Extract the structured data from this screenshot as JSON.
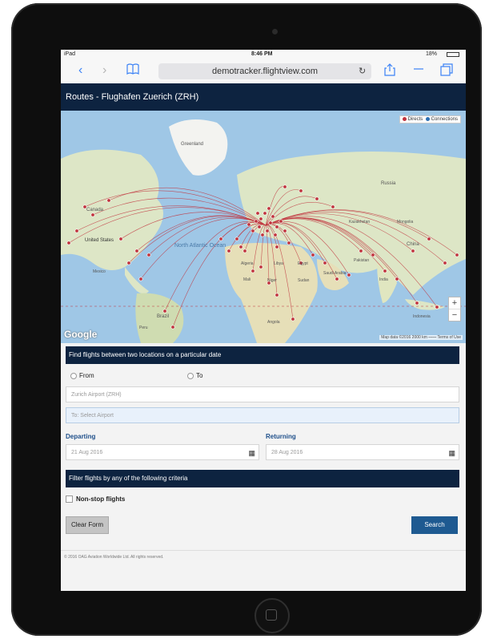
{
  "status_bar": {
    "carrier": "iPad",
    "time": "8:46 PM",
    "battery": "18%"
  },
  "browser": {
    "url": "demotracker.flightview.com"
  },
  "header": {
    "title": "Routes - Flughafen Zuerich (ZRH)"
  },
  "map": {
    "legend_direct": "Directs",
    "legend_connections": "Connections",
    "labels": {
      "greenland": "Greenland",
      "canada": "Canada",
      "united_states": "United States",
      "mexico": "Mexico",
      "north_atlantic": "North Atlantic Ocean",
      "brazil": "Brazil",
      "algeria": "Algeria",
      "mali": "Mali",
      "niger": "Niger",
      "libya": "Libya",
      "egypt": "Egypt",
      "sudan": "Sudan",
      "saudi_arabia": "Saudi Arabia",
      "pakistan": "Pakistan",
      "india": "India",
      "kazakhstan": "Kazakhstan",
      "russia": "Russia",
      "mongolia": "Mongolia",
      "china": "China",
      "indonesia": "Indonesia",
      "angola": "Angola",
      "peru": "Peru"
    },
    "google": "Google",
    "attribution": "Map data ©2016   2000 km ⎯⎯⎯⎯   Terms of Use",
    "zoom_in": "+",
    "zoom_out": "−",
    "colors": {
      "route": "#c0333d",
      "water": "#9fc7e6",
      "land": "#dfe8c8"
    }
  },
  "form": {
    "section_title": "Find flights between two locations on a particular date",
    "radio_from": "From",
    "radio_to": "To",
    "from_value": "Zurich Airport (ZRH)",
    "to_placeholder": "To: Select Airport",
    "departing_label": "Departing",
    "returning_label": "Returning",
    "departing_value": "21 Aug 2016",
    "returning_value": "28 Aug 2016",
    "filter_title": "Filter flights by any of the following criteria",
    "nonstop_label": "Non-stop flights",
    "clear_button": "Clear Form",
    "search_button": "Search",
    "footer": "© 2016 OAG Aviation Worldwide Ltd. All rights reserved."
  }
}
